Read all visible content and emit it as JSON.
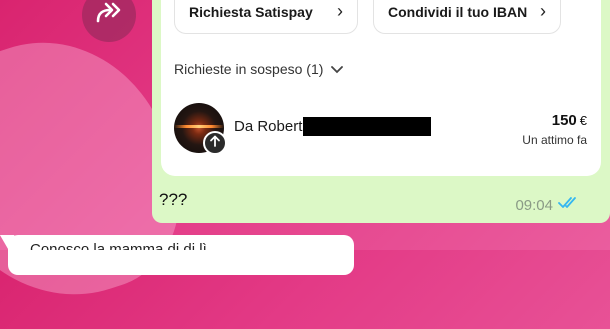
{
  "actions": {
    "satispay_label": "Richiesta Satispay",
    "iban_label": "Condividi il tuo IBAN",
    "chevron": "›"
  },
  "pending": {
    "header": "Richieste in sospeso (1)",
    "toggle": "⌄"
  },
  "request": {
    "sender": "Da Robert",
    "amount": "150",
    "currency": "€",
    "time_ago": "Un attimo fa"
  },
  "message": {
    "text": "???",
    "timestamp": "09:04",
    "read_status": "read"
  },
  "next_message": {
    "partial_text": "Conosco la mamma di di lì"
  },
  "colors": {
    "bubble_bg": "#dcf8c6",
    "background": "#e33a86",
    "read_ticks": "#34b7f1"
  },
  "icons": [
    "forward-icon",
    "chevron-right-icon",
    "chevron-down-icon",
    "arrow-up-icon",
    "double-check-icon"
  ]
}
